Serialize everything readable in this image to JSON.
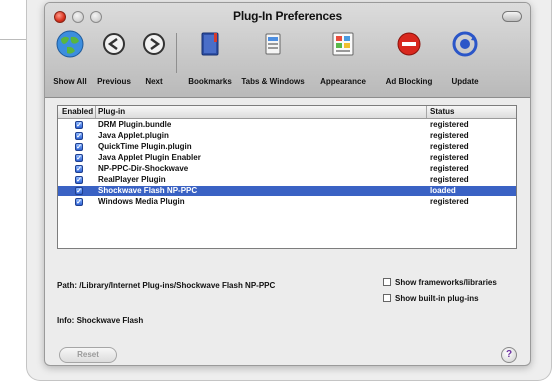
{
  "window": {
    "title": "Plug-In Preferences"
  },
  "toolbar": {
    "items": [
      {
        "label": "Show All",
        "icon": "globe-icon"
      },
      {
        "label": "Previous",
        "icon": "back-arrow-icon"
      },
      {
        "label": "Next",
        "icon": "forward-arrow-icon"
      },
      {
        "label": "Bookmarks",
        "icon": "bookmarks-book-icon"
      },
      {
        "label": "Tabs & Windows",
        "icon": "tabs-windows-icon"
      },
      {
        "label": "Appearance",
        "icon": "appearance-palette-icon"
      },
      {
        "label": "Ad Blocking",
        "icon": "ad-blocking-icon"
      },
      {
        "label": "Update",
        "icon": "update-icon"
      }
    ]
  },
  "table": {
    "columns": {
      "enabled": "Enabled",
      "plugin": "Plug-in",
      "status": "Status"
    },
    "rows": [
      {
        "name": "DRM Plugin.bundle",
        "status": "registered",
        "enabled": true,
        "selected": false
      },
      {
        "name": "Java Applet.plugin",
        "status": "registered",
        "enabled": true,
        "selected": false
      },
      {
        "name": "QuickTime Plugin.plugin",
        "status": "registered",
        "enabled": true,
        "selected": false
      },
      {
        "name": "Java Applet Plugin Enabler",
        "status": "registered",
        "enabled": true,
        "selected": false
      },
      {
        "name": "NP-PPC-Dir-Shockwave",
        "status": "registered",
        "enabled": true,
        "selected": false
      },
      {
        "name": "RealPlayer Plugin",
        "status": "registered",
        "enabled": true,
        "selected": false
      },
      {
        "name": "Shockwave Flash NP-PPC",
        "status": "loaded",
        "enabled": true,
        "selected": true
      },
      {
        "name": "Windows Media Plugin",
        "status": "registered",
        "enabled": true,
        "selected": false
      }
    ]
  },
  "details": {
    "path_label": "Path:",
    "path_value": "/Library/Internet Plug-ins/Shockwave Flash NP-PPC",
    "info_label": "Info:",
    "info_value": "Shockwave Flash"
  },
  "options": {
    "show_frameworks": "Show frameworks/libraries",
    "show_builtin": "Show built-in plug-ins"
  },
  "buttons": {
    "reset": "Reset",
    "help": "?"
  },
  "colors": {
    "selection": "#3a62c4",
    "window_bg": "#ececec",
    "toolbar_bg": "#c8c8c8",
    "checkbox": "#2d62d4"
  }
}
